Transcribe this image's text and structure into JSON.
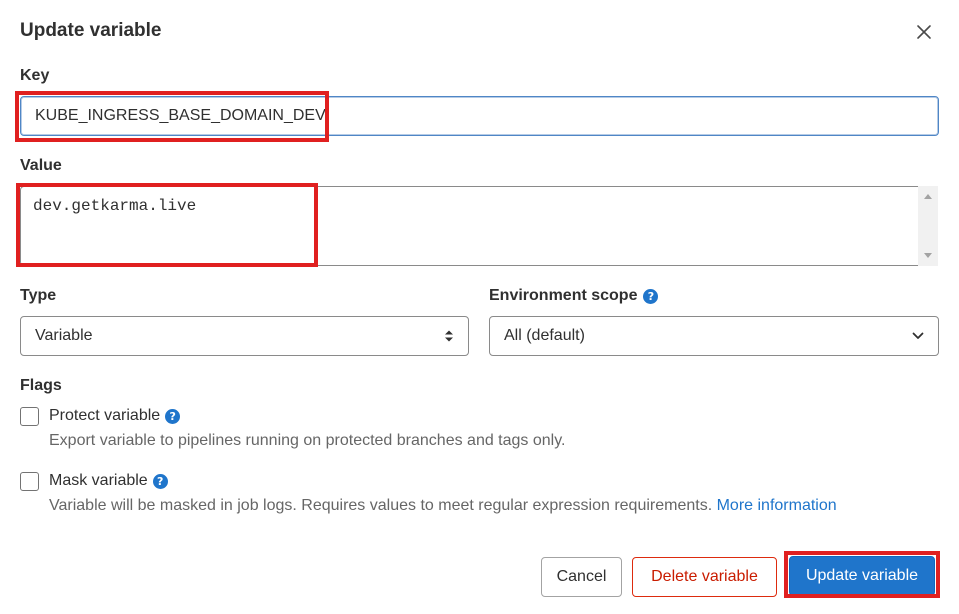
{
  "dialog": {
    "title": "Update variable",
    "close_icon": "close-icon"
  },
  "form": {
    "key": {
      "label": "Key",
      "value": "KUBE_INGRESS_BASE_DOMAIN_DEV"
    },
    "value": {
      "label": "Value",
      "value": "dev.getkarma.live"
    },
    "type": {
      "label": "Type",
      "selected": "Variable"
    },
    "environment_scope": {
      "label": "Environment scope",
      "selected": "All (default)"
    },
    "flags": {
      "label": "Flags",
      "protect": {
        "label": "Protect variable",
        "checked": false,
        "description": "Export variable to pipelines running on protected branches and tags only."
      },
      "mask": {
        "label": "Mask variable",
        "checked": false,
        "description": "Variable will be masked in job logs. Requires values to meet regular expression requirements.",
        "link": "More information"
      }
    }
  },
  "actions": {
    "cancel": "Cancel",
    "delete": "Delete variable",
    "update": "Update variable"
  },
  "colors": {
    "primary": "#1f75cb",
    "danger": "#dd2b0e",
    "highlight": "#e02020"
  }
}
